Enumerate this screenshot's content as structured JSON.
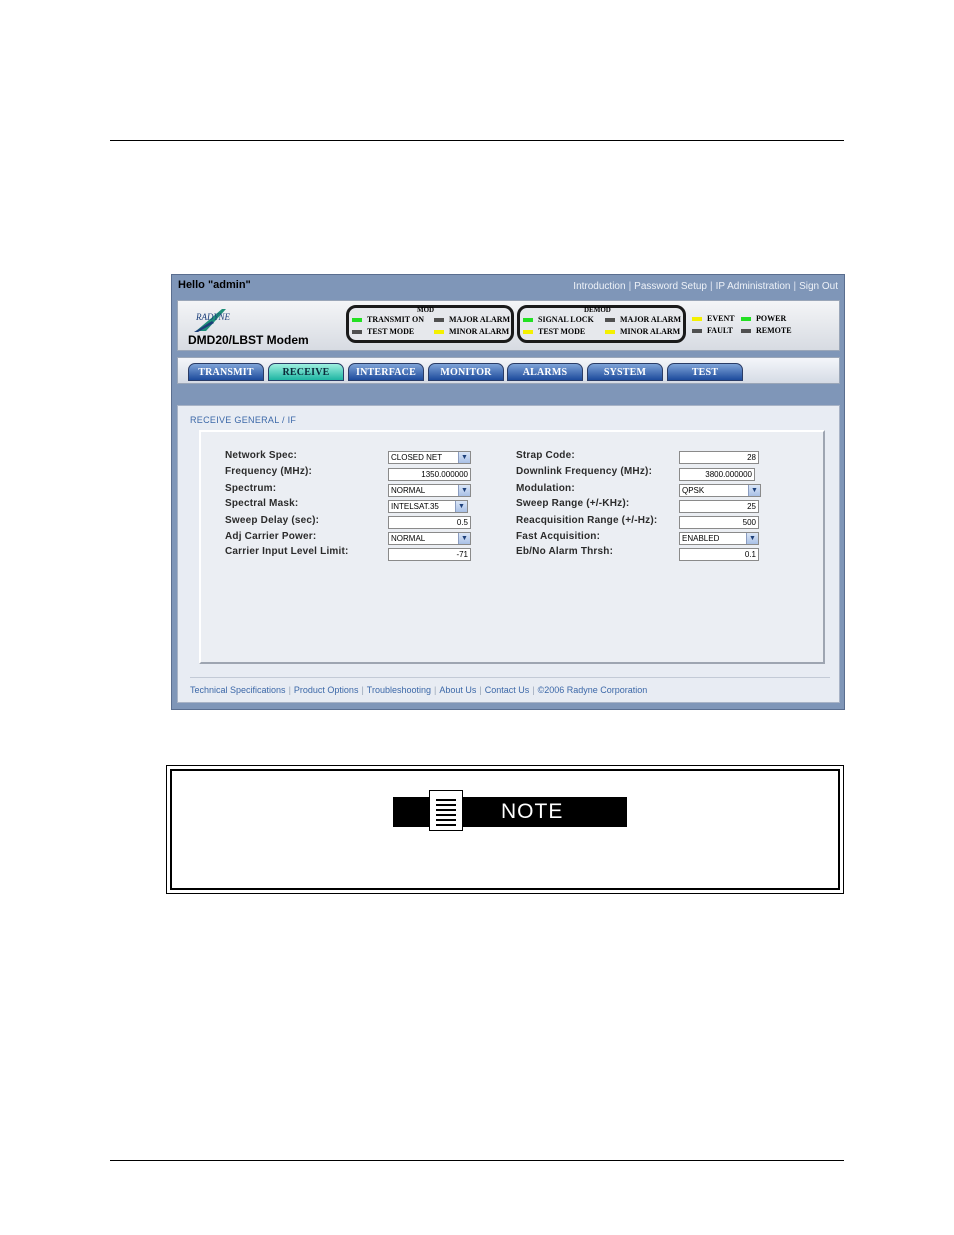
{
  "screenshot": {
    "greeting": "Hello \"admin\"",
    "top_links": [
      "Introduction",
      "Password Setup",
      "IP Administration",
      "Sign Out"
    ],
    "logo_text": "RADYNE",
    "model": "DMD20/LBST Modem",
    "mod_group": {
      "caption": "MOD",
      "leds": [
        {
          "label": "TRANSMIT ON",
          "color": "#23e023"
        },
        {
          "label": "MAJOR ALARM",
          "color": "#505050"
        },
        {
          "label": "TEST MODE",
          "color": "#505050"
        },
        {
          "label": "MINOR ALARM",
          "color": "#f4f000"
        }
      ]
    },
    "demod_group": {
      "caption": "DEMOD",
      "leds": [
        {
          "label": "SIGNAL LOCK",
          "color": "#23e023"
        },
        {
          "label": "MAJOR ALARM",
          "color": "#505050"
        },
        {
          "label": "TEST MODE",
          "color": "#f4f000"
        },
        {
          "label": "MINOR ALARM",
          "color": "#f4f000"
        }
      ]
    },
    "status_leds": [
      {
        "label": "EVENT",
        "color": "#f4f000"
      },
      {
        "label": "POWER",
        "color": "#23e023"
      },
      {
        "label": "FAULT",
        "color": "#505050"
      },
      {
        "label": "REMOTE",
        "color": "#505050"
      }
    ],
    "tabs": [
      "TRANSMIT",
      "RECEIVE",
      "INTERFACE",
      "MONITOR",
      "ALARMS",
      "SYSTEM",
      "TEST"
    ],
    "active_tab": "RECEIVE",
    "section_title": "RECEIVE GENERAL / IF",
    "left_fields": [
      {
        "label": "Network Spec:",
        "value": "CLOSED NET",
        "kind": "select"
      },
      {
        "label": "Frequency (MHz):",
        "value": "1350.000000",
        "kind": "input"
      },
      {
        "label": "Spectrum:",
        "value": "NORMAL",
        "kind": "select"
      },
      {
        "label": "Spectral Mask:",
        "value": "INTELSAT.35",
        "kind": "select"
      },
      {
        "label": "Sweep Delay (sec):",
        "value": "0.5",
        "kind": "input"
      },
      {
        "label": "Adj Carrier Power:",
        "value": "NORMAL",
        "kind": "select"
      },
      {
        "label": "Carrier Input Level Limit:",
        "value": "-71",
        "kind": "input"
      }
    ],
    "right_fields": [
      {
        "label": "Strap Code:",
        "value": "28",
        "kind": "input"
      },
      {
        "label": "Downlink Frequency (MHz):",
        "value": "3800.000000",
        "kind": "input"
      },
      {
        "label": "Modulation:",
        "value": "QPSK",
        "kind": "select"
      },
      {
        "label": "Sweep Range (+/-KHz):",
        "value": "25",
        "kind": "input"
      },
      {
        "label": "Reacquisition Range (+/-Hz):",
        "value": "500",
        "kind": "input"
      },
      {
        "label": "Fast Acquisition:",
        "value": "ENABLED",
        "kind": "select"
      },
      {
        "label": "Eb/No Alarm Thrsh:",
        "value": "0.1",
        "kind": "input"
      }
    ],
    "footer_links": [
      "Technical Specifications",
      "Product Options",
      "Troubleshooting",
      "About Us",
      "Contact Us",
      "©2006 Radyne Corporation"
    ]
  },
  "note": {
    "label": "NOTE"
  }
}
